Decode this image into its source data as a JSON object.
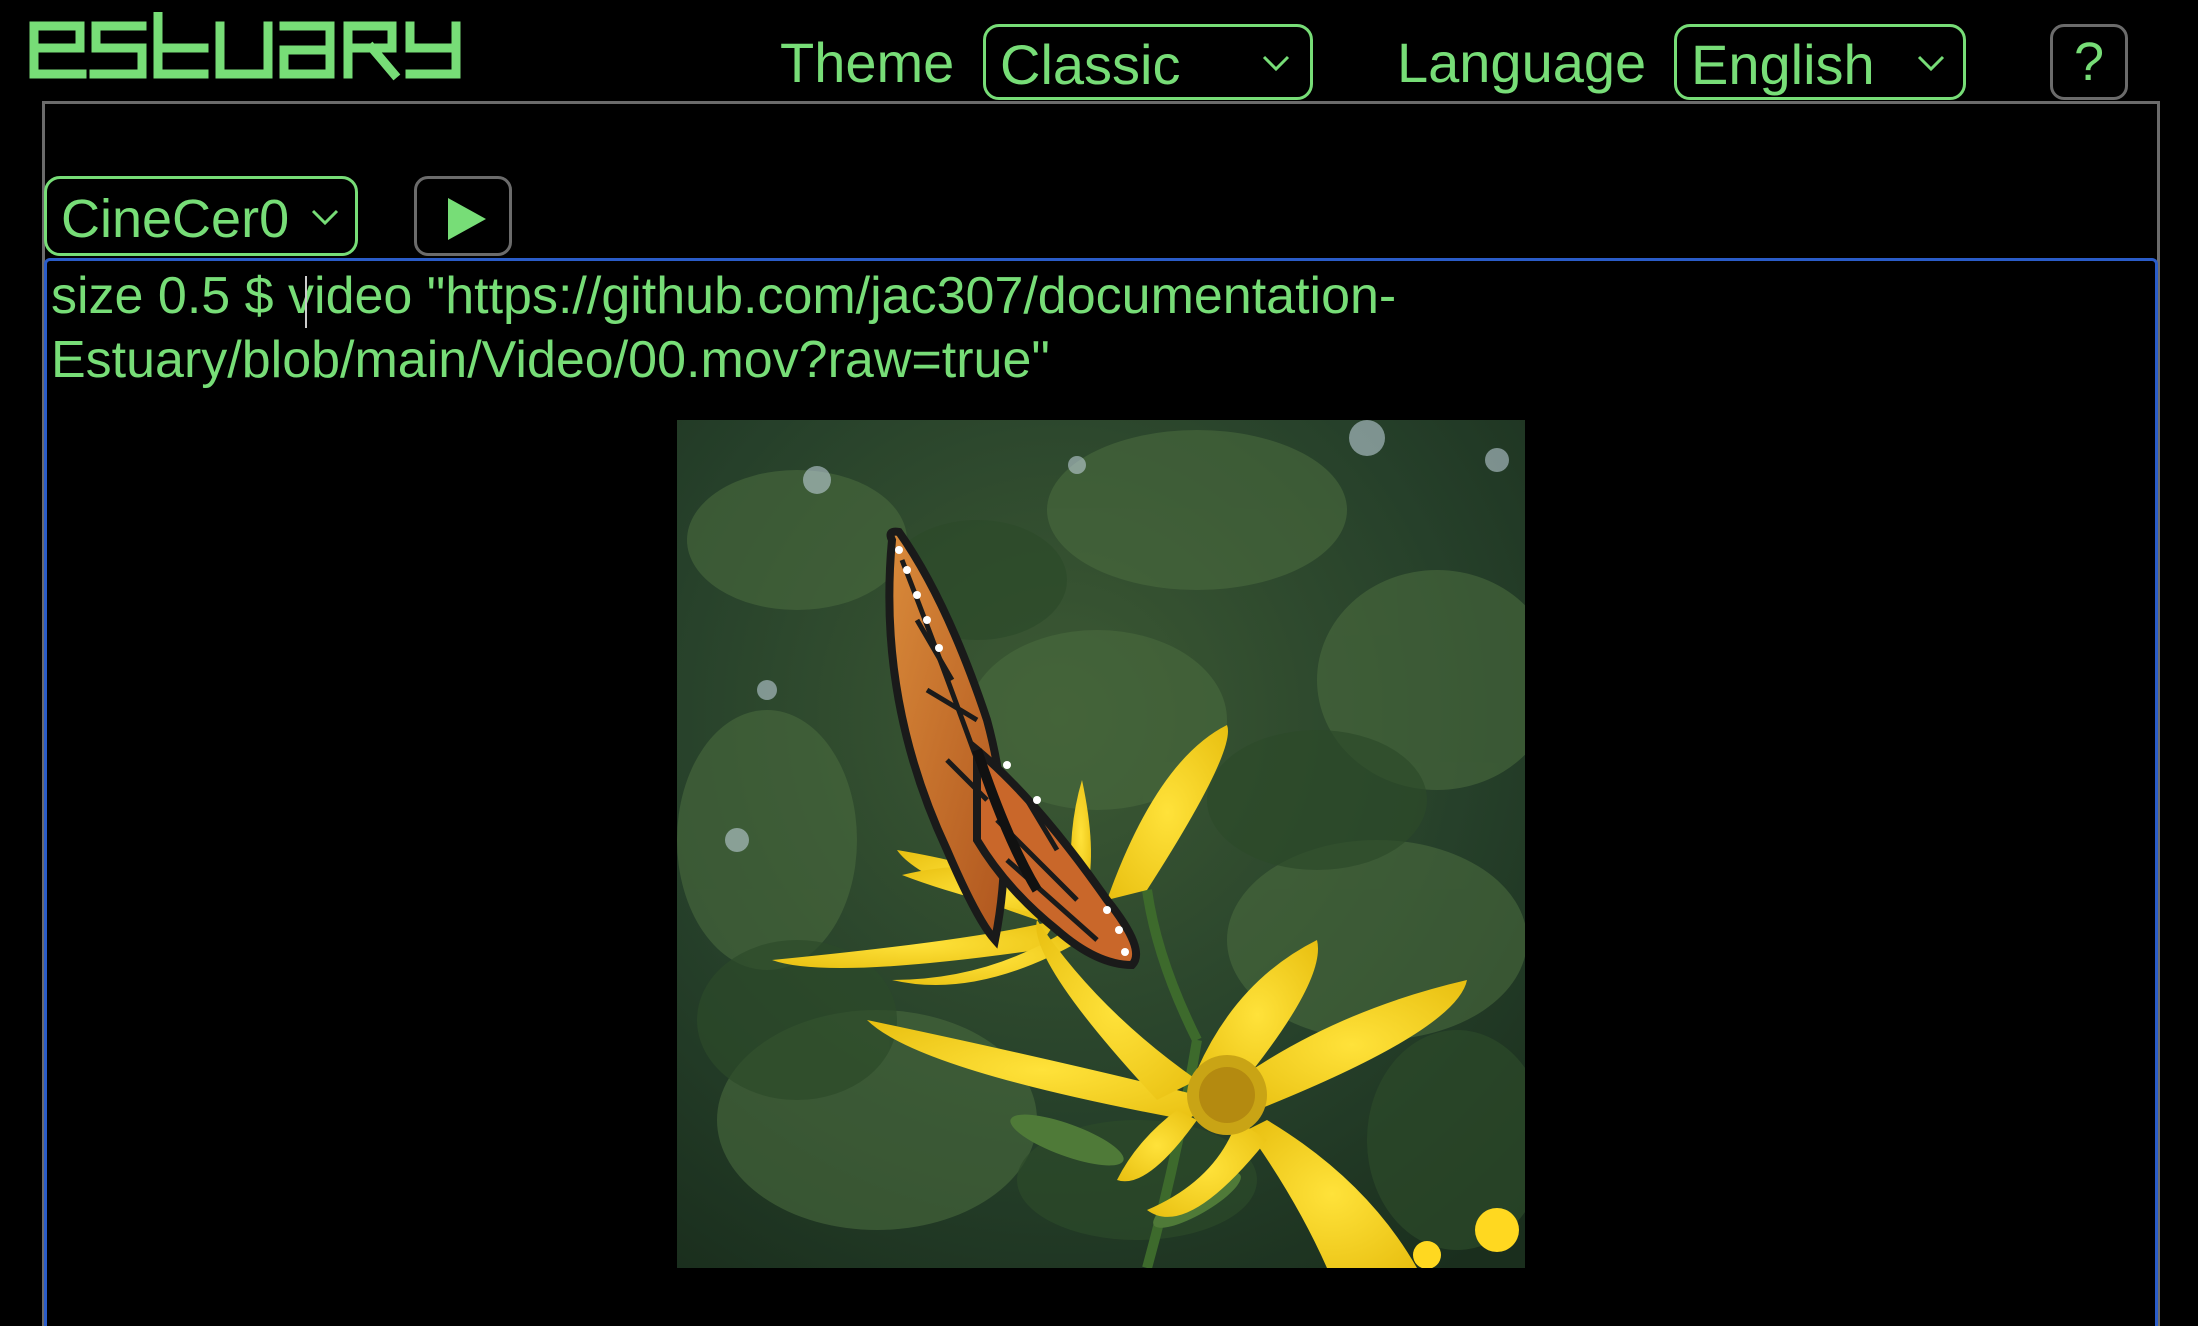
{
  "app": {
    "logo_text": "estuary"
  },
  "header": {
    "theme_label": "Theme",
    "theme_value": "Classic",
    "language_label": "Language",
    "language_value": "English",
    "help_label": "?"
  },
  "editor": {
    "language_select": "CineCer0",
    "play_icon": "play-icon",
    "code_line_1": "size 0.5 $ video \"https://github.com/jac307/documentation-",
    "code_line_2": "Estuary/blob/main/Video/00.mov?raw=true\""
  },
  "output": {
    "video_content": "monarch butterfly on yellow flower"
  },
  "colors": {
    "accent": "#77dd77",
    "background": "#000000",
    "panel_border": "#6b6b6b",
    "editor_focus_border": "#2a5cc8"
  }
}
